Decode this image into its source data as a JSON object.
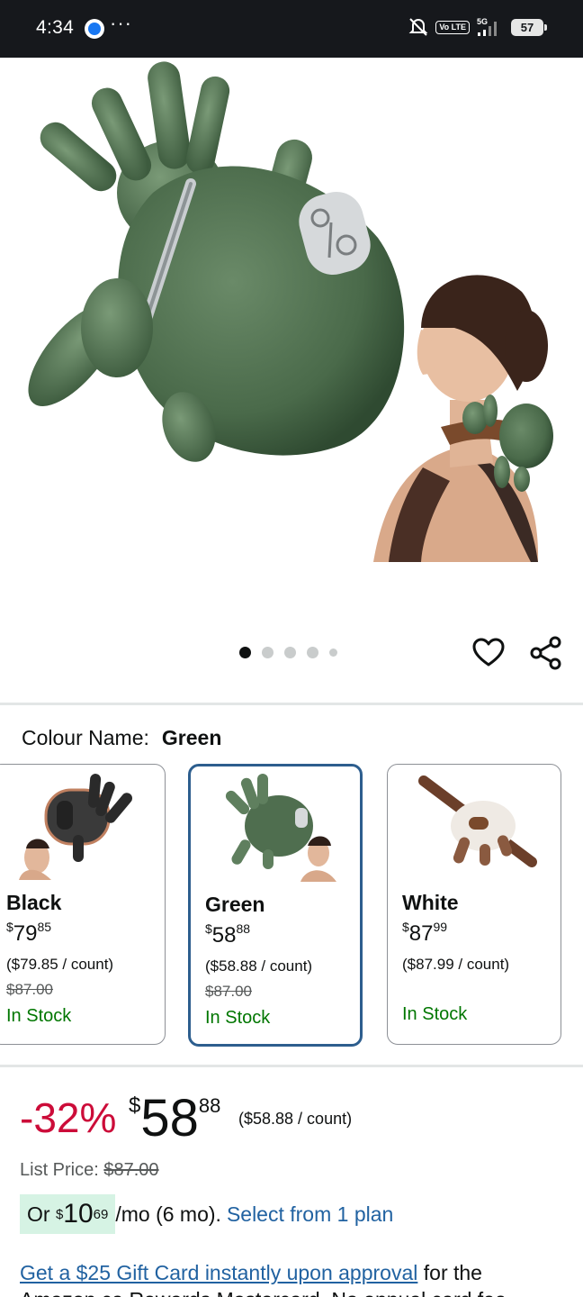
{
  "status_bar": {
    "time": "4:34",
    "more": "···",
    "network_badge": "Vo LTE",
    "network_type": "5G",
    "battery": "57"
  },
  "gallery": {
    "dots": 5,
    "active_index": 0
  },
  "colour": {
    "label": "Colour Name:",
    "value": "Green"
  },
  "swatches": [
    {
      "name": "Black",
      "price_currency": "$",
      "price_whole": "79",
      "price_cents": "85",
      "unit_price": "($79.85 / count)",
      "was_price": "$87.00",
      "stock": "In Stock",
      "selected": false
    },
    {
      "name": "Green",
      "price_currency": "$",
      "price_whole": "58",
      "price_cents": "88",
      "unit_price": "($58.88 / count)",
      "was_price": "$87.00",
      "stock": "In Stock",
      "selected": true
    },
    {
      "name": "White",
      "price_currency": "$",
      "price_whole": "87",
      "price_cents": "99",
      "unit_price": "($87.99 / count)",
      "was_price": "",
      "stock": "In Stock",
      "selected": false
    }
  ],
  "price": {
    "discount": "-32%",
    "currency": "$",
    "whole": "58",
    "cents": "88",
    "per_unit": "($58.88 / count)",
    "list_label": "List Price:",
    "list_value": "$87.00"
  },
  "monthly": {
    "prefix": "Or",
    "currency": "$",
    "whole": "10",
    "cents": "69",
    "suffix": "/mo (6 mo).",
    "link": "Select from 1 plan"
  },
  "gift": {
    "link": "Get a $25 Gift Card instantly upon approval",
    "text": " for the Amazon.ca Rewards Mastercard. No annual card fee."
  },
  "colors": {
    "status_bg": "#16181c",
    "link": "#2162a1",
    "deal_red": "#cc0c39",
    "in_stock": "#007600",
    "selected_border": "#2d5e8e",
    "product_green": "#4f6e4f"
  }
}
